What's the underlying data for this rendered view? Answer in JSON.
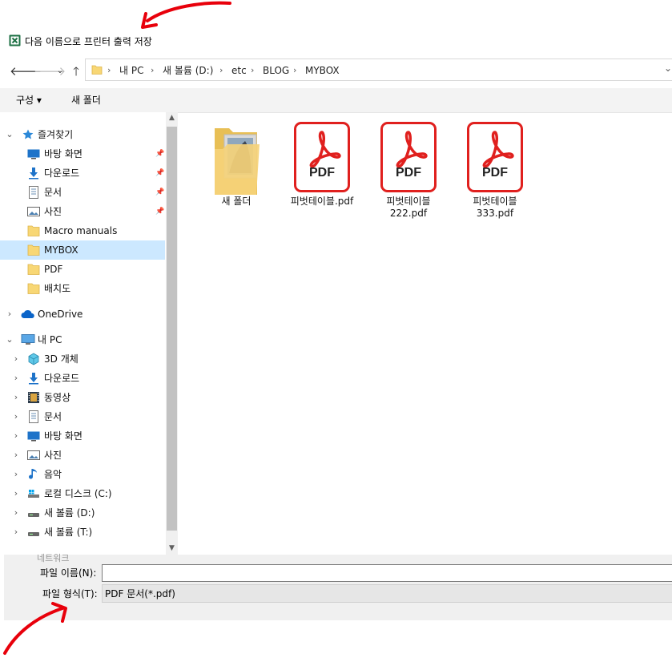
{
  "dialog": {
    "title": "다음 이름으로 프린터 출력 저장",
    "app_icon": "excel-icon"
  },
  "address": {
    "back_icon": "arrow-left-icon",
    "forward_icon": "arrow-right-icon",
    "recent_icon": "chevron-down-icon",
    "up_icon": "arrow-up-icon",
    "crumbs": [
      "내 PC",
      "새 볼륨 (D:)",
      "etc",
      "BLOG",
      "MYBOX"
    ],
    "separator": "›",
    "dropdown_glyph": "⌄"
  },
  "toolbar": {
    "organize": "구성 ▾",
    "new_folder": "새 폴더"
  },
  "nav": {
    "quick_access": "즐겨찾기",
    "quick_items": [
      {
        "label": "바탕 화면",
        "icon": "desktop-icon"
      },
      {
        "label": "다운로드",
        "icon": "download-icon"
      },
      {
        "label": "문서",
        "icon": "document-icon"
      },
      {
        "label": "사진",
        "icon": "pictures-icon"
      },
      {
        "label": "Macro manuals",
        "icon": "folder-icon"
      },
      {
        "label": "MYBOX",
        "icon": "folder-icon"
      },
      {
        "label": "PDF",
        "icon": "folder-icon"
      },
      {
        "label": "배치도",
        "icon": "folder-icon"
      }
    ],
    "onedrive": "OneDrive",
    "this_pc": "내 PC",
    "pc_items": [
      {
        "label": "3D 개체",
        "icon": "3d-objects-icon"
      },
      {
        "label": "다운로드",
        "icon": "download-icon"
      },
      {
        "label": "동영상",
        "icon": "video-icon"
      },
      {
        "label": "문서",
        "icon": "document-icon"
      },
      {
        "label": "바탕 화면",
        "icon": "desktop-icon"
      },
      {
        "label": "사진",
        "icon": "pictures-icon"
      },
      {
        "label": "음악",
        "icon": "music-icon"
      },
      {
        "label": "로컬 디스크 (C:)",
        "icon": "local-disk-icon"
      },
      {
        "label": "새 볼륨 (D:)",
        "icon": "drive-icon"
      },
      {
        "label": "새 볼륨 (T:)",
        "icon": "drive-icon"
      }
    ],
    "partial_item": "네트워크"
  },
  "files": [
    {
      "name": "새 폴더",
      "type": "folder"
    },
    {
      "name": "피벗테이블.pdf",
      "type": "pdf"
    },
    {
      "name": "피벗테이블\n222.pdf",
      "type": "pdf"
    },
    {
      "name": "피벗테이블\n333.pdf",
      "type": "pdf"
    }
  ],
  "pdf_badge": "PDF",
  "bottom": {
    "filename_label": "파일 이름(N):",
    "filename_value": "",
    "filetype_label": "파일 형식(T):",
    "filetype_value": "PDF 문서(*.pdf)"
  },
  "colors": {
    "selection": "#cce8ff",
    "pdf_red": "#e0201e",
    "annotation_red": "#e8000b"
  }
}
